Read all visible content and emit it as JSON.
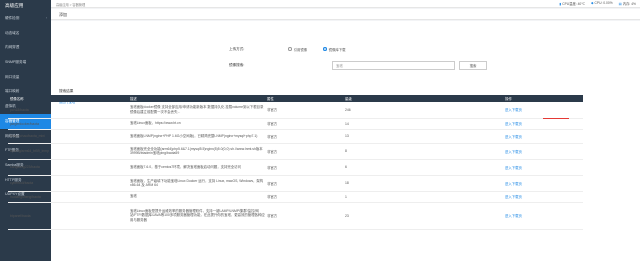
{
  "sidebar": {
    "brand": "高级应用",
    "items": [
      {
        "label": "硬件检测",
        "active": false,
        "chevron": "›"
      },
      {
        "label": "动态域名",
        "active": false,
        "chevron": ""
      },
      {
        "label": "内网穿透",
        "active": false,
        "chevron": ""
      },
      {
        "label": "SNMP服务端",
        "active": false,
        "chevron": ""
      },
      {
        "label": "网口流量",
        "active": false,
        "chevron": ""
      },
      {
        "label": "端口映射",
        "active": false,
        "chevron": ""
      },
      {
        "label": "虚拟机",
        "active": false,
        "chevron": ""
      },
      {
        "label": "容器管理",
        "active": true,
        "chevron": ""
      },
      {
        "label": "网络唤醒",
        "active": false,
        "chevron": ""
      },
      {
        "label": "FTP服务",
        "active": false,
        "chevron": ""
      },
      {
        "label": "Samba服务",
        "active": false,
        "chevron": ""
      },
      {
        "label": "HTTP服务",
        "active": false,
        "chevron": ""
      },
      {
        "label": "UDPXY设置",
        "active": false,
        "chevron": ""
      }
    ]
  },
  "topbar": {
    "breadcrumb": "高级应用 > 容器管理",
    "cpu_temp": "CPU温度: 40℃",
    "cpu": "CPU: 0.00%",
    "mem": "内存: 4%"
  },
  "tab": {
    "label": "添加"
  },
  "form": {
    "upload_label": "上传方式:",
    "radio_local": "引用镜像",
    "radio_online": "镜像库下载",
    "search_label": "镜像搜索:",
    "search_placeholder": "宝塔",
    "search_button": "搜索"
  },
  "results": {
    "title": "搜索结果",
    "links": "返回 | 宝塔",
    "columns": [
      "镜像名称",
      "描述",
      "属性",
      "星级",
      "操作"
    ],
    "rows": [
      {
        "name": "pch18/baota",
        "desc": "宝塔面板docker镜像 支持全部应用/申请功能新版本 数据持久化 挂载volume到以下根目录镜像后建立前配置一次不会丢失...",
        "type": "非官方",
        "stars": "246",
        "action": "进入下载页"
      },
      {
        "name": "jaegerdocker/baota",
        "desc": "宝塔Linux面板，https://www.bt.cn",
        "type": "非官方",
        "stars": "14",
        "action": "进入下载页"
      },
      {
        "name": "beiyuechao/baota_mini",
        "desc": "宝塔面板LNMP(nginx+PHP 1.6G小空间版)，已精简完整LNMP(nginx+mysql+php7.1)",
        "type": "非官方",
        "stars": "13",
        "action": "进入下载页"
      },
      {
        "name": "aplsing/arm64_bt59_lnmp",
        "desc": "宝塔面板完全全功能(arm64)php5.6&7.1(mysql5.5)nginx(5)5.0(0,0) sh.//www.lnmt.sh版本3999B/btadmin宝塔ping/baota59",
        "type": "非官方",
        "stars": "8",
        "action": "进入下载页"
      },
      {
        "name": "kangkang223/baota",
        "desc": "宝塔面板7.6.0，基于centos7环境，解决宝塔面板启动问题，支持完全访问",
        "type": "非官方",
        "stars": "6",
        "action": "进入下载页"
      },
      {
        "name": "cyberbolt/baota",
        "desc": "宝塔面板，生产级填下功能宝塔Linux Docker 运行，支持 Linux, macOS, Windows，架构 x86-64 及 ARM 64",
        "type": "非官方",
        "stars": "18",
        "action": "进入下载页"
      },
      {
        "name": "huolangsheng/baota",
        "desc": "宝塔",
        "type": "非官方",
        "stars": "1",
        "action": "进入下载页"
      },
      {
        "name": "btpanel/baota",
        "desc": "宝塔Linux面板是提升运维效率的服务器管理软件，支持一键LAMP/LNMP/集群/监控/网站/FTP/数据库/JAVA等100多项服务器管理功能，在此提升你的宝塔，更高效的管理各种应用与服务器",
        "type": "非官方",
        "stars": "23",
        "action": "进入下载页"
      }
    ]
  }
}
